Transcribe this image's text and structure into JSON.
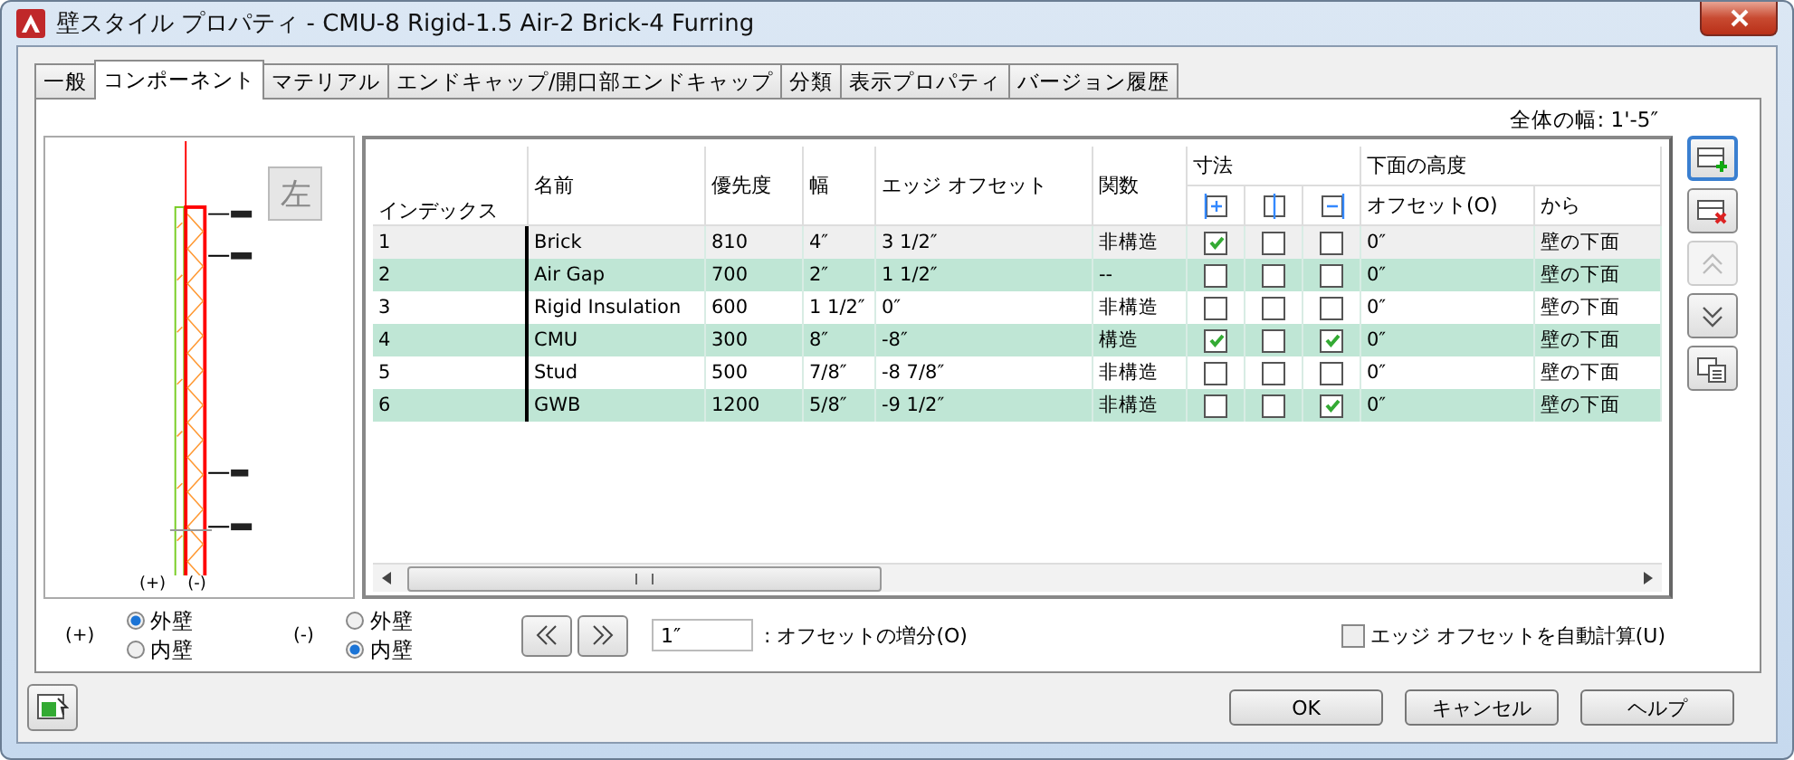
{
  "window": {
    "title": "壁スタイル プロパティ - CMU-8 Rigid-1.5 Air-2 Brick-4 Furring"
  },
  "tabs": [
    {
      "label": "一般",
      "selected": false
    },
    {
      "label": "コンポーネント",
      "selected": true
    },
    {
      "label": "マテリアル",
      "selected": false
    },
    {
      "label": "エンドキャップ/開口部エンドキャップ",
      "selected": false
    },
    {
      "label": "分類",
      "selected": false
    },
    {
      "label": "表示プロパティ",
      "selected": false
    },
    {
      "label": "バージョン履歴",
      "selected": false
    }
  ],
  "total_width": "全体の幅: 1'-5″",
  "preview": {
    "side_button": "左",
    "plus_label": "(+)",
    "minus_label": "(-)"
  },
  "table": {
    "columns": [
      "インデックス",
      "名前",
      "優先度",
      "幅",
      "エッジ オフセット",
      "関数"
    ],
    "dimension_header": "寸法",
    "elevation_header": "下面の高度",
    "elevation_columns": [
      "オフセット(O)",
      "から"
    ],
    "rows": [
      {
        "index": "1",
        "name": "Brick",
        "priority": "810",
        "width": "4″",
        "edge_offset": "3 1/2″",
        "function": "非構造",
        "dims": [
          true,
          false,
          false
        ],
        "offset": "0″",
        "from": "壁の下面",
        "selected": true
      },
      {
        "index": "2",
        "name": "Air Gap",
        "priority": "700",
        "width": "2″",
        "edge_offset": "1 1/2″",
        "function": "--",
        "dims": [
          false,
          false,
          false
        ],
        "offset": "0″",
        "from": "壁の下面",
        "selected": false
      },
      {
        "index": "3",
        "name": "Rigid Insulation",
        "priority": "600",
        "width": "1 1/2″",
        "edge_offset": "0″",
        "function": "非構造",
        "dims": [
          false,
          false,
          false
        ],
        "offset": "0″",
        "from": "壁の下面",
        "selected": false
      },
      {
        "index": "4",
        "name": "CMU",
        "priority": "300",
        "width": "8″",
        "edge_offset": "-8″",
        "function": "構造",
        "dims": [
          true,
          false,
          true
        ],
        "offset": "0″",
        "from": "壁の下面",
        "selected": false
      },
      {
        "index": "5",
        "name": "Stud",
        "priority": "500",
        "width": "7/8″",
        "edge_offset": "-8 7/8″",
        "function": "非構造",
        "dims": [
          false,
          false,
          false
        ],
        "offset": "0″",
        "from": "壁の下面",
        "selected": false
      },
      {
        "index": "6",
        "name": "GWB",
        "priority": "1200",
        "width": "5/8″",
        "edge_offset": "-9 1/2″",
        "function": "非構造",
        "dims": [
          false,
          false,
          true
        ],
        "offset": "0″",
        "from": "壁の下面",
        "selected": false
      }
    ]
  },
  "side_buttons": [
    {
      "kind": "add",
      "disabled": false
    },
    {
      "kind": "delete",
      "disabled": false
    },
    {
      "kind": "up",
      "disabled": true
    },
    {
      "kind": "down",
      "disabled": false
    },
    {
      "kind": "list",
      "disabled": false
    }
  ],
  "radio_groups": [
    {
      "label": "(+)",
      "options": [
        {
          "label": "外壁",
          "selected": true
        },
        {
          "label": "内壁",
          "selected": false
        }
      ]
    },
    {
      "label": "(-)",
      "options": [
        {
          "label": "外壁",
          "selected": false
        },
        {
          "label": "内壁",
          "selected": true
        }
      ]
    }
  ],
  "increment": {
    "value": "1″",
    "label": ": オフセットの増分(O)"
  },
  "auto_offset": {
    "label": "エッジ オフセットを自動計算(U)",
    "checked": false
  },
  "buttons": [
    "OK",
    "キャンセル",
    "ヘルプ"
  ]
}
